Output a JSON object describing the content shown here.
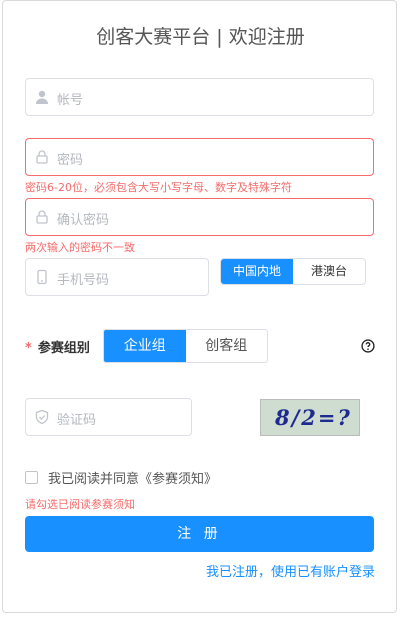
{
  "page": {
    "title": "创客大赛平台 | 欢迎注册"
  },
  "form": {
    "account": {
      "placeholder": "帐号"
    },
    "password": {
      "placeholder": "密码",
      "error": "密码6-20位，必须包含大写小写字母、数字及特殊字符"
    },
    "confirm_password": {
      "placeholder": "确认密码",
      "error": "两次输入的密码不一致"
    },
    "phone": {
      "placeholder": "手机号码"
    },
    "region": {
      "options": [
        "中国内地",
        "港澳台"
      ],
      "selected": "中国内地"
    },
    "group": {
      "label": "参赛组别",
      "required_mark": "*",
      "options": [
        "企业组",
        "创客组"
      ],
      "selected": "企业组"
    },
    "captcha": {
      "placeholder": "验证码",
      "image_text": "8/2=?"
    },
    "agreement": {
      "label": "我已阅读并同意《参赛须知》",
      "checked": false,
      "error": "请勾选已阅读参赛须知"
    },
    "submit_label": "注 册",
    "login_link": "我已注册，使用已有账户登录"
  },
  "colors": {
    "primary": "#1890ff",
    "error": "#f56c6c",
    "border": "#dcdfe6",
    "placeholder": "#b4b8bf"
  },
  "icons": [
    "user-icon",
    "lock-icon",
    "phone-icon",
    "shield-icon",
    "help-icon"
  ]
}
